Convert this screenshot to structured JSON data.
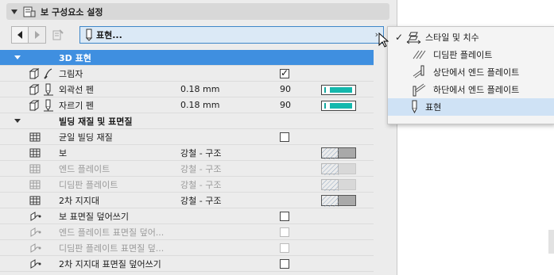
{
  "header": {
    "title": "보 구성요소 설정",
    "icon": "settings-page-icon"
  },
  "toolbar": {
    "prev_icon": "arrow-left-icon",
    "next_icon": "arrow-right-icon",
    "panel_icon": "panel-settings-icon"
  },
  "selector": {
    "label": "표현...",
    "icon": "pen-pencil-icon"
  },
  "rows": [
    {
      "kind": "group",
      "label": "3D 표현",
      "selected": true
    },
    {
      "kind": "item",
      "label": "그림자",
      "checked": true
    },
    {
      "kind": "item",
      "label": "외곽선 펜",
      "value": "0.18 mm",
      "pen": "90"
    },
    {
      "kind": "item",
      "label": "자르기 펜",
      "value": "0.18 mm",
      "pen": "90"
    },
    {
      "kind": "group",
      "label": "빌딩 재질 및 표면질"
    },
    {
      "kind": "item",
      "label": "균일 빌딩 재질",
      "checked": false
    },
    {
      "kind": "item",
      "label": "보",
      "value": "강철 - 구조"
    },
    {
      "kind": "item",
      "label": "엔드 플레이트",
      "value": "강철 - 구조",
      "disabled": true
    },
    {
      "kind": "item",
      "label": "디딤판 플레이트",
      "value": "강철 - 구조",
      "disabled": true
    },
    {
      "kind": "item",
      "label": "2차 지지대",
      "value": "강철 - 구조"
    },
    {
      "kind": "item",
      "label": "보 표면질 덮어쓰기",
      "checked": false
    },
    {
      "kind": "item",
      "label": "엔드 플레이트 표면질 덮어...",
      "checked": false,
      "disabled": true
    },
    {
      "kind": "item",
      "label": "디딤판 플레이트 표면질 덮...",
      "checked": false,
      "disabled": true
    },
    {
      "kind": "item",
      "label": "2차 지지대 표면질 덮어쓰기",
      "checked": false
    }
  ],
  "popup": {
    "items": [
      {
        "label": "스타일 및 치수",
        "checked": true,
        "icon": "style-dimension-icon"
      },
      {
        "label": "디딤판 플레이트",
        "icon": "tread-plate-icon"
      },
      {
        "label": "상단에서 엔드 플레이트",
        "icon": "end-plate-top-icon"
      },
      {
        "label": "하단에서 엔드 플레이트",
        "icon": "end-plate-bottom-icon"
      },
      {
        "label": "표현",
        "selected": true,
        "icon": "pen-pencil-icon"
      }
    ]
  },
  "colors": {
    "selected_row": "#3f8fe0",
    "popup_selected": "#cfe2f5",
    "pen_teal": "#14b8ad"
  }
}
